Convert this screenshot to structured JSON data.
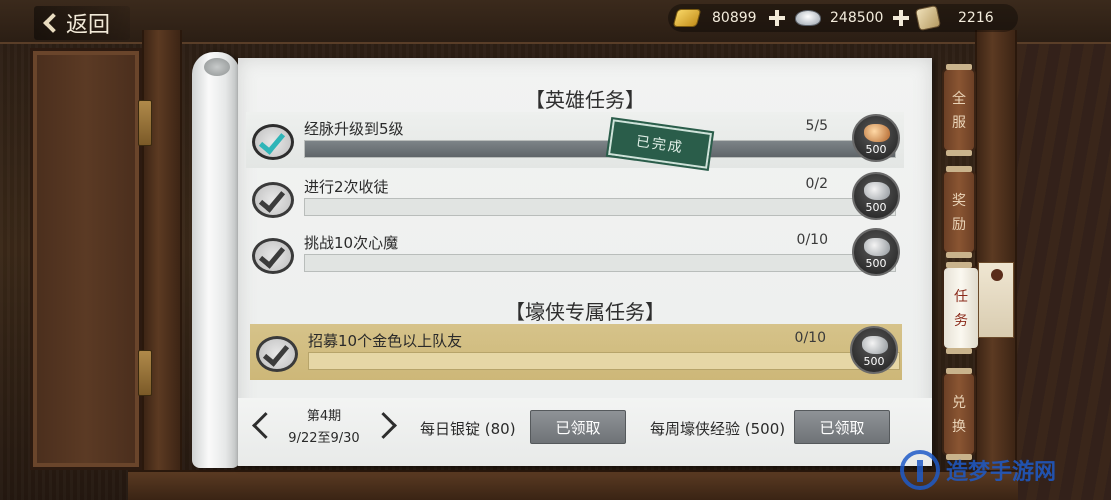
{
  "header": {
    "back_label": "返回",
    "currencies": [
      {
        "icon": "gold-ingot-icon",
        "value": "80899"
      },
      {
        "icon": "silver-ingot-icon",
        "value": "248500"
      },
      {
        "icon": "scroll-icon",
        "value": "2216"
      }
    ]
  },
  "sections": {
    "hero_title": "【英雄任务】",
    "exclusive_title": "【壕侠专属任务】"
  },
  "hero_tasks": [
    {
      "name": "经脉升级到5级",
      "progress": "5/5",
      "fraction": 1.0,
      "reward": "500",
      "completed": true
    },
    {
      "name": "进行2次收徒",
      "progress": "0/2",
      "fraction": 0,
      "reward": "500",
      "completed": false
    },
    {
      "name": "挑战10次心魔",
      "progress": "0/10",
      "fraction": 0,
      "reward": "500",
      "completed": false
    }
  ],
  "exclusive_tasks": [
    {
      "name": "招募10个金色以上队友",
      "progress": "0/10",
      "fraction": 0,
      "reward": "500",
      "completed": false
    }
  ],
  "stamp_text": "已完成",
  "footer": {
    "period_label": "第4期",
    "period_dates": "9/22至9/30",
    "daily_label": "每日银锭 (80)",
    "daily_button": "已领取",
    "weekly_label": "每周壕侠经验 (500)",
    "weekly_button": "已领取"
  },
  "side_tabs": [
    {
      "label_1": "全",
      "label_2": "服"
    },
    {
      "label_1": "奖",
      "label_2": "励"
    },
    {
      "label_1": "任",
      "label_2": "务"
    },
    {
      "label_1": "兑",
      "label_2": "换"
    }
  ],
  "watermark": "造梦手游网",
  "colors": {
    "completed_check": "#2fb5b8",
    "highlight_row": "#d6c38a",
    "stamp": "#2a5d4a",
    "claimed_button": "#7f8387"
  }
}
